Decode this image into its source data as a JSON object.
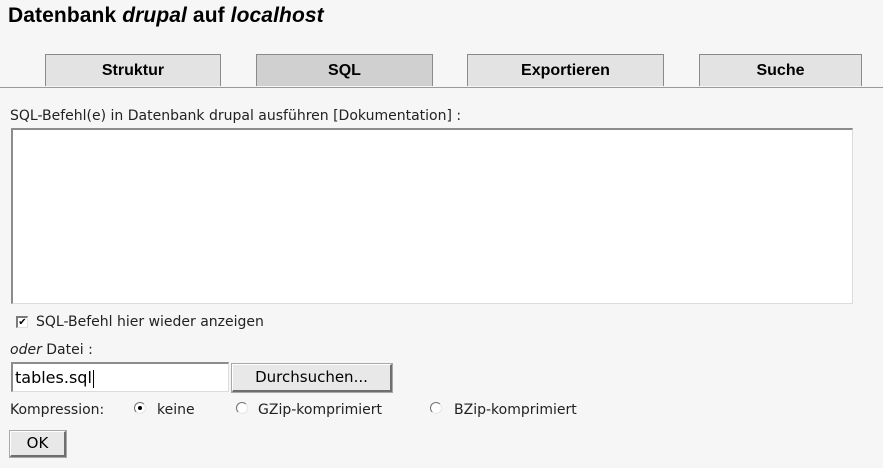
{
  "header": {
    "title_prefix": "Datenbank ",
    "db_name": "drupal",
    "title_middle": " auf ",
    "host": "localhost"
  },
  "tabs": [
    {
      "label": "Struktur",
      "active": false
    },
    {
      "label": "SQL",
      "active": true
    },
    {
      "label": "Exportieren",
      "active": false
    },
    {
      "label": "Suche",
      "active": false
    }
  ],
  "sql": {
    "label": "SQL-Befehl(e) in Datenbank drupal ausführen [Dokumentation] :",
    "query_value": "",
    "show_again_label": "SQL-Befehl hier wieder anzeigen",
    "show_again_checked": true
  },
  "file": {
    "oder": "oder",
    "label": " Datei :",
    "value": "tables.sql",
    "browse_label": "Durchsuchen..."
  },
  "compression": {
    "label": "Kompression:",
    "options": [
      {
        "label": "keine",
        "selected": true
      },
      {
        "label": "GZip-komprimiert",
        "selected": false
      },
      {
        "label": "BZip-komprimiert",
        "selected": false
      }
    ]
  },
  "submit_label": "OK"
}
